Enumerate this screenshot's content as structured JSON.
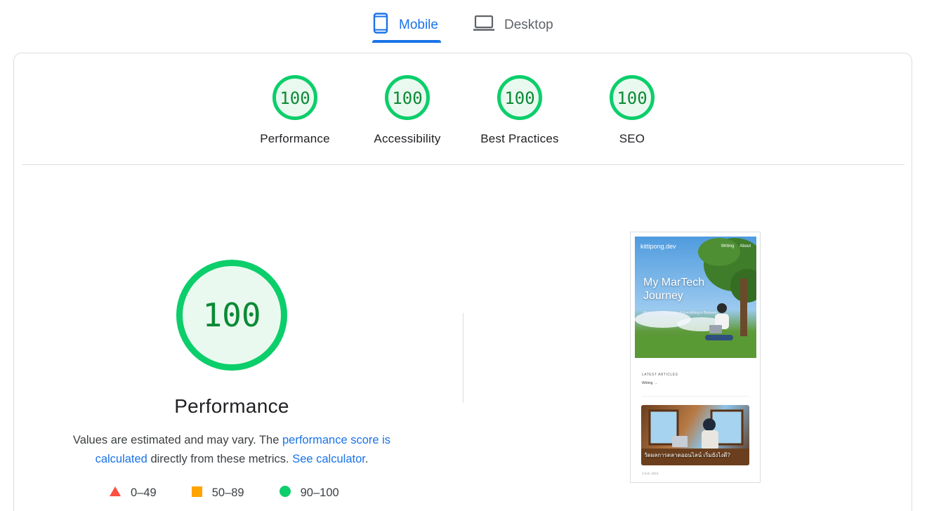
{
  "tabs": [
    {
      "label": "Mobile",
      "icon": "smartphone-icon",
      "active": true
    },
    {
      "label": "Desktop",
      "icon": "laptop-icon",
      "active": false
    }
  ],
  "categories": [
    {
      "score": "100",
      "label": "Performance"
    },
    {
      "score": "100",
      "label": "Accessibility"
    },
    {
      "score": "100",
      "label": "Best Practices"
    },
    {
      "score": "100",
      "label": "SEO"
    }
  ],
  "performance": {
    "score": "100",
    "title": "Performance",
    "desc_prefix": "Values are estimated and may vary. The ",
    "link_score": "performance score is calculated",
    "desc_middle": " directly from these metrics. ",
    "link_calc": "See calculator",
    "desc_suffix": "."
  },
  "legend": [
    {
      "range": "0–49",
      "shape": "triangle",
      "color": "#ff4e42"
    },
    {
      "range": "50–89",
      "shape": "square",
      "color": "#ffa400"
    },
    {
      "range": "90–100",
      "shape": "circle",
      "color": "#0cce6b"
    }
  ],
  "colors": {
    "accent": "#1a73e8",
    "pass_ring": "#0cce6b",
    "pass_fill": "#eaf9ef",
    "pass_text": "#0b8a36"
  },
  "thumbnail": {
    "site_name": "kittipong.dev",
    "nav": [
      "Writing",
      "About"
    ],
    "hero_title": "My MarTech Journey",
    "hero_subtitle": "Marketing, Technology & Everything in Between",
    "latest_label": "LATEST ARTICLES",
    "latest_link": "Writing →",
    "article_caption": "วัดผลการตลาดออนไลน์ เริ่มยังไงดี?",
    "article_date": "3 ส.ค. 2024"
  }
}
